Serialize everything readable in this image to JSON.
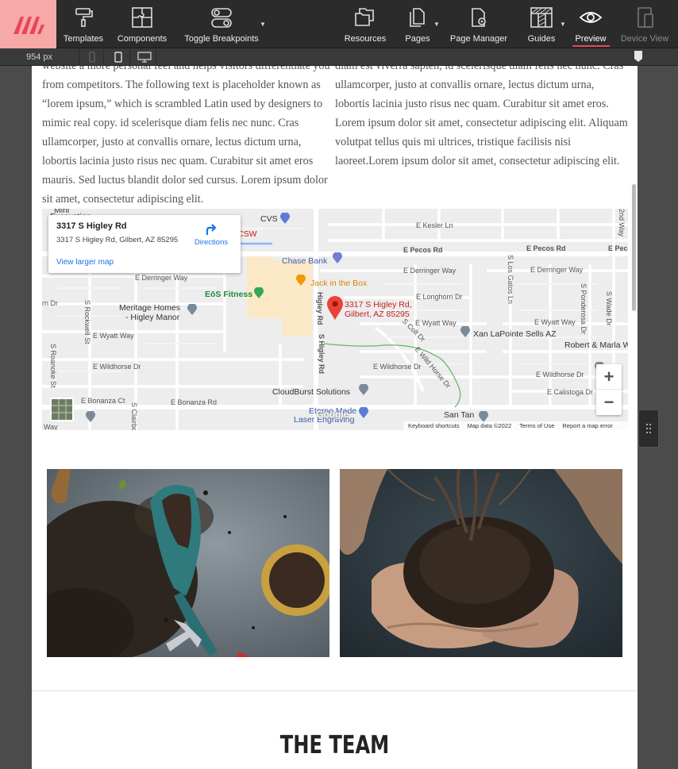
{
  "toolbar": {
    "items": [
      {
        "label": "Templates",
        "icon": "paint-roller-icon"
      },
      {
        "label": "Components",
        "icon": "puzzle-icon"
      },
      {
        "label": "Toggle Breakpoints",
        "icon": "toggle-icon"
      },
      {
        "label": "Resources",
        "icon": "folders-icon"
      },
      {
        "label": "Pages",
        "icon": "pages-icon"
      },
      {
        "label": "Page Manager",
        "icon": "page-manager-icon"
      },
      {
        "label": "Guides",
        "icon": "guides-icon"
      },
      {
        "label": "Preview",
        "icon": "eye-icon",
        "active": true
      },
      {
        "label": "Device View",
        "icon": "device-view-icon",
        "disabled": true
      }
    ],
    "accent_color": "#e8455a",
    "logo_bg": "#f7a9a8"
  },
  "breakpoints": {
    "width_label": "954 px"
  },
  "content": {
    "left_column": "website a more personal feel and helps visitors differentiate you from competitors. The following text is placeholder known as “lorem ipsum,” which is scrambled Latin used by designers to mimic real copy. id scelerisque diam felis nec nunc. Cras ullamcorper, justo at convallis ornare, lectus dictum urna, lobortis lacinia justo risus nec quam. Curabitur sit amet eros mauris. Sed luctus blandit dolor sed cursus. Lorem ipsum dolor sit amet, consectetur adipiscing elit.",
    "right_column": "diam est viverra sapien, id scelerisque diam felis nec nunc. Cras ullamcorper, justo at convallis ornare, lectus dictum urna, lobortis lacinia justo risus nec quam. Curabitur sit amet eros. Lorem ipsum dolor sit amet, consectetur adipiscing elit. Aliquam volutpat tellus quis mi ultrices, tristique facilisis nisi laoreet.Lorem ipsum dolor sit amet, consectetur adipiscing elit."
  },
  "map": {
    "info_title": "3317 S Higley Rd",
    "info_address": "3317 S Higley Rd, Gilbert, AZ 85295",
    "directions_label": "Directions",
    "view_larger": "View larger map",
    "pin_label_line1": "3317 S Higley Rd,",
    "pin_label_line2": "Gilbert, AZ 85295",
    "zoom_in": "+",
    "zoom_out": "−",
    "footer": {
      "shortcuts": "Keyboard shortcuts",
      "data": "Map data ©2022",
      "terms": "Terms of Use",
      "report": "Report a map error"
    },
    "google": "Google",
    "pois": {
      "cvs": "CVS",
      "csw": "CSW",
      "chase": "Chase Bank",
      "jack": "Jack in the Box",
      "eos": "EōS Fitness",
      "meritage1": "Meritage Homes",
      "meritage2": "- Higley Manor",
      "xan": "Xan LaPointe Sells AZ",
      "robert": "Robert & Marla W",
      "cloudburst": "CloudBurst Solutions",
      "etemo1": "Eterno Made",
      "etemo2": "Laser Engraving",
      "santan": "San Tan",
      "mini": "Mini",
      "excavation": "Excavation"
    },
    "roads": {
      "kesler": "E Kesler Ln",
      "pecos1": "E Pecos Rd",
      "pecos2": "E Pecos Rd",
      "pecos3": "E Pec",
      "derringer1": "E Derringer Way",
      "derringer2": "E Derringer Way",
      "derringer3": "E Derringer Way",
      "longhorn": "E Longhorn Dr",
      "wyatt1": "E Wyatt Way",
      "wyatt2": "E Wyatt Way",
      "wyatt3": "E Wyatt Way",
      "wildhorse1": "E Wildhorse Dr",
      "wildhorse2": "E Wildhorse Dr",
      "wildhorse3": "E Wildhorse Dr",
      "bonanza1": "E Bonanza Ct",
      "bonanza2": "E Bonanza Rd",
      "calistoga": "E Calistoga Dr",
      "rn": "rn Dr",
      "higley1": "Higley Rd",
      "higley2": "S Higley Rd",
      "rockwell": "S Rockwell St",
      "roanoke": "S Roanoke St",
      "clairbor": "S Clairbo",
      "losgatos": "S Los Gatos Ln",
      "ponderosa": "S Ponderosa Dr",
      "wade": "S Wade Dr",
      "second": "2nd Way",
      "colt": "S Colt Dr",
      "horse": "E Wild Horse Dr",
      "way": "Way"
    }
  },
  "team": {
    "title": "THE TEAM"
  }
}
